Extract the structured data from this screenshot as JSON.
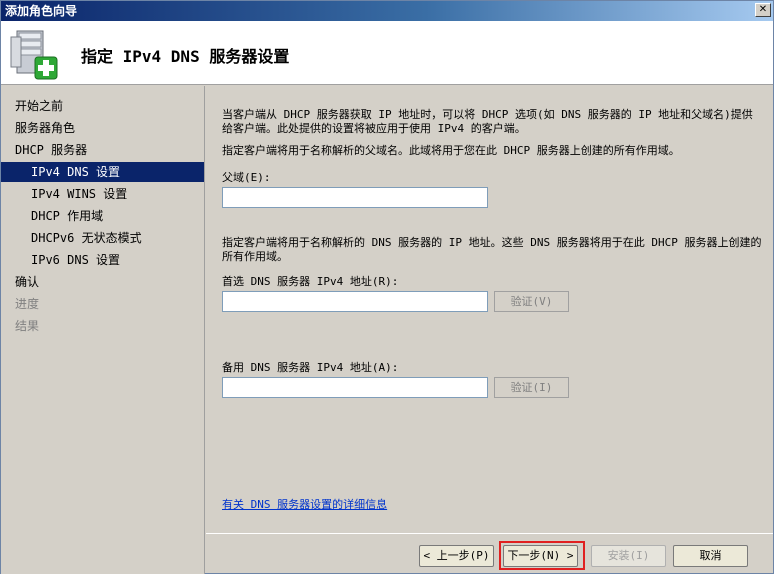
{
  "window": {
    "title": "添加角色向导",
    "close_glyph": "✕"
  },
  "header": {
    "title": "指定 IPv4 DNS 服务器设置",
    "icon": "server-add-icon"
  },
  "sidebar": {
    "items": [
      {
        "label": "开始之前"
      },
      {
        "label": "服务器角色"
      },
      {
        "label": "DHCP 服务器"
      },
      {
        "label": "IPv4 DNS 设置"
      },
      {
        "label": "IPv4 WINS 设置"
      },
      {
        "label": "DHCP 作用域"
      },
      {
        "label": "DHCPv6 无状态模式"
      },
      {
        "label": "IPv6 DNS 设置"
      },
      {
        "label": "确认"
      },
      {
        "label": "进度"
      },
      {
        "label": "结果"
      }
    ]
  },
  "content": {
    "intro": "当客户端从 DHCP 服务器获取 IP 地址时，可以将 DHCP 选项(如 DNS 服务器的 IP 地址和父域名)提供给客户端。此处提供的设置将被应用于使用 IPv4 的客户端。",
    "parent_domain_desc": "指定客户端将用于名称解析的父域名。此域将用于您在此 DHCP 服务器上创建的所有作用域。",
    "parent_domain_label": "父域(E):",
    "parent_domain_value": "",
    "dns_desc": "指定客户端将用于名称解析的 DNS 服务器的 IP 地址。这些 DNS 服务器将用于在此 DHCP 服务器上创建的所有作用域。",
    "preferred_label": "首选 DNS 服务器 IPv4 地址(R):",
    "preferred_value": "",
    "verify_preferred": "验证(V)",
    "alternate_label": "备用 DNS 服务器 IPv4 地址(A):",
    "alternate_value": "",
    "verify_alternate": "验证(I)",
    "more_info_link": "有关 DNS 服务器设置的详细信息"
  },
  "footer": {
    "back": "< 上一步(P)",
    "next": "下一步(N) >",
    "install": "安装(I)",
    "cancel": "取消"
  },
  "colors": {
    "selected_bg": "#0a246a",
    "link": "#0033cc",
    "highlight": "#e02020"
  }
}
